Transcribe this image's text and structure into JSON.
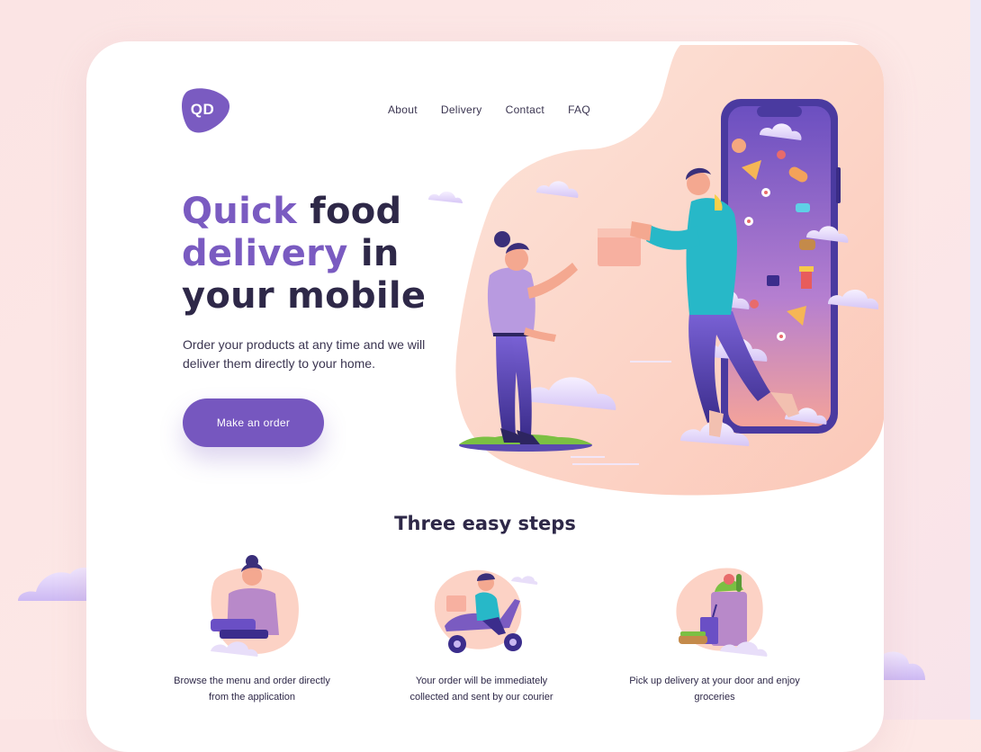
{
  "brand": {
    "logo_text": "QD",
    "accent": "#7657bf",
    "accent_light": "#7a5bc1",
    "ink": "#2e2848"
  },
  "nav": {
    "items": [
      "About",
      "Delivery",
      "Contact",
      "FAQ"
    ]
  },
  "hero": {
    "headline_line1_accent": "Quick",
    "headline_line1_rest": " food",
    "headline_line2_accent": "delivery",
    "headline_line2_rest": " in",
    "headline_line3": "your mobile",
    "subtitle": "Order your products at any time and we will deliver them directly to your home.",
    "cta_label": "Make an order"
  },
  "steps": {
    "title": "Three easy steps",
    "items": [
      {
        "text": "Browse the menu and order directly from the application",
        "icon": "person-laptop-icon"
      },
      {
        "text": "Your order will be immediately collected and sent by our courier",
        "icon": "courier-scooter-icon"
      },
      {
        "text": "Pick up delivery at your door and enjoy groceries",
        "icon": "grocery-bag-icon"
      }
    ]
  },
  "illustration": {
    "scene": "courier-hands-box-from-phone",
    "colors": {
      "blob": "#fcd2c5",
      "phone": "#4a3aa0",
      "cloud": "#e6dcfb"
    }
  }
}
